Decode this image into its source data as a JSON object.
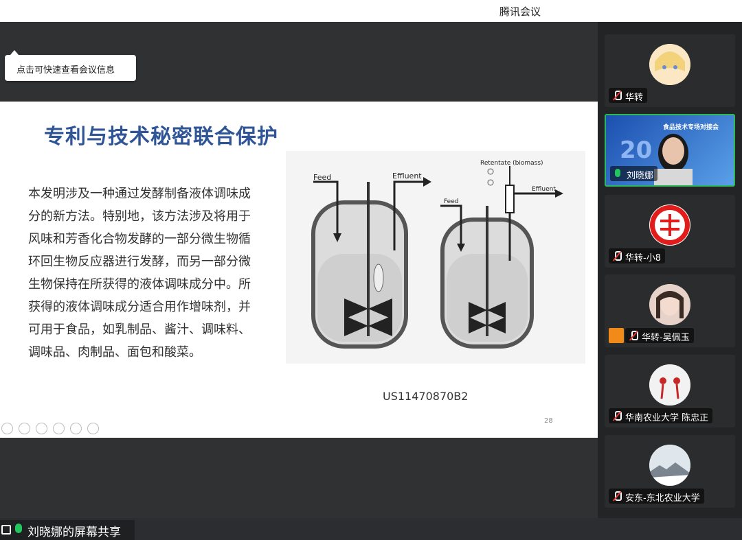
{
  "window": {
    "title": "腾讯会议"
  },
  "tooltip": {
    "text": "点击可快速查看会议信息"
  },
  "slide": {
    "title": "专利与技术秘密联合保护",
    "body": "本发明涉及一种通过发酵制备液体调味成分的新方法。特别地，该方法涉及将用于风味和芳香化合物发酵的一部分微生物循环回生物反应器进行发酵，而另一部分微生物保持在所获得的液体调味成分中。所获得的液体调味成分适合用作增味剂，并可用于食品，如乳制品、酱汁、调味料、调味品、肉制品、面包和酸菜。",
    "figure_labels": {
      "feed_left": "Feed",
      "effluent_left": "Effluent",
      "retentate": "Retentate (biomass)",
      "feed_right": "Feed",
      "effluent_right": "Effluent"
    },
    "patent_number": "US11470870B2",
    "page_number": "28"
  },
  "share": {
    "label": "刘晓娜的屏幕共享"
  },
  "participants": [
    {
      "name": "华转",
      "mic": "off"
    },
    {
      "name": "刘晓娜",
      "mic": "on",
      "banner_text": "食品技术专场对接会"
    },
    {
      "name": "华转-小8",
      "mic": "off"
    },
    {
      "name": "华转-吴佩玉",
      "mic": "off"
    },
    {
      "name": "华南农业大学 陈忠正",
      "mic": "off"
    },
    {
      "name": "安东-东北农业大学",
      "mic": "off"
    }
  ],
  "colors": {
    "title_blue": "#2f5597",
    "active_border": "#2fb85a",
    "mic_on": "#22c55e",
    "mic_off_slash": "#e53935"
  }
}
